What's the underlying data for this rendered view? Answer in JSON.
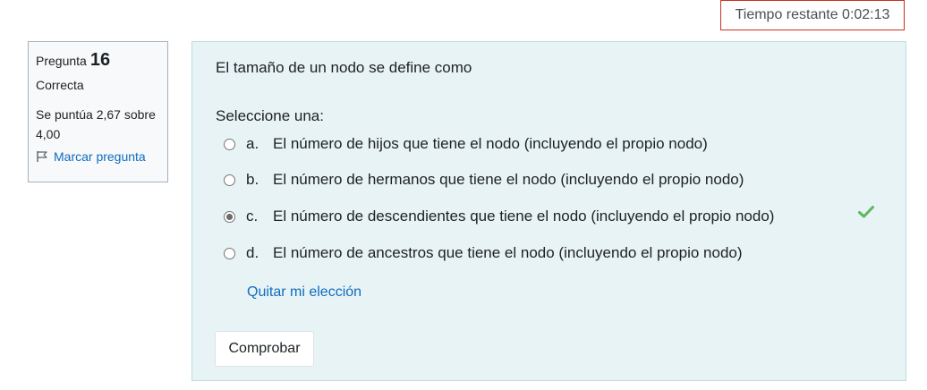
{
  "timer": {
    "text": "Tiempo restante 0:02:13"
  },
  "info": {
    "question_label": "Pregunta",
    "question_number": "16",
    "state": "Correcta",
    "grade": "Se puntúa 2,67 sobre 4,00",
    "flag_label": "Marcar pregunta",
    "flag_icon": "flag-icon"
  },
  "question": {
    "text": "El tamaño de un nodo se define como",
    "prompt": "Seleccione una:",
    "answers": [
      {
        "letter": "a.",
        "text": "El número de hijos que tiene el nodo (incluyendo el propio nodo)",
        "selected": false
      },
      {
        "letter": "b.",
        "text": "El número de hermanos que tiene el nodo (incluyendo el propio nodo)",
        "selected": false
      },
      {
        "letter": "c.",
        "text": "El número de descendientes que tiene el nodo (incluyendo el propio nodo)",
        "selected": true,
        "correct_icon": "checkmark-icon"
      },
      {
        "letter": "d.",
        "text": "El número de ancestros que tiene el nodo (incluyendo el propio nodo)",
        "selected": false
      }
    ],
    "clear_label": "Quitar mi elección",
    "check_button": "Comprobar"
  },
  "colors": {
    "accent": "#0f6cbf",
    "correct": "#5cb85c",
    "timer_border": "#ca3120",
    "content_bg": "#e7f3f5"
  }
}
